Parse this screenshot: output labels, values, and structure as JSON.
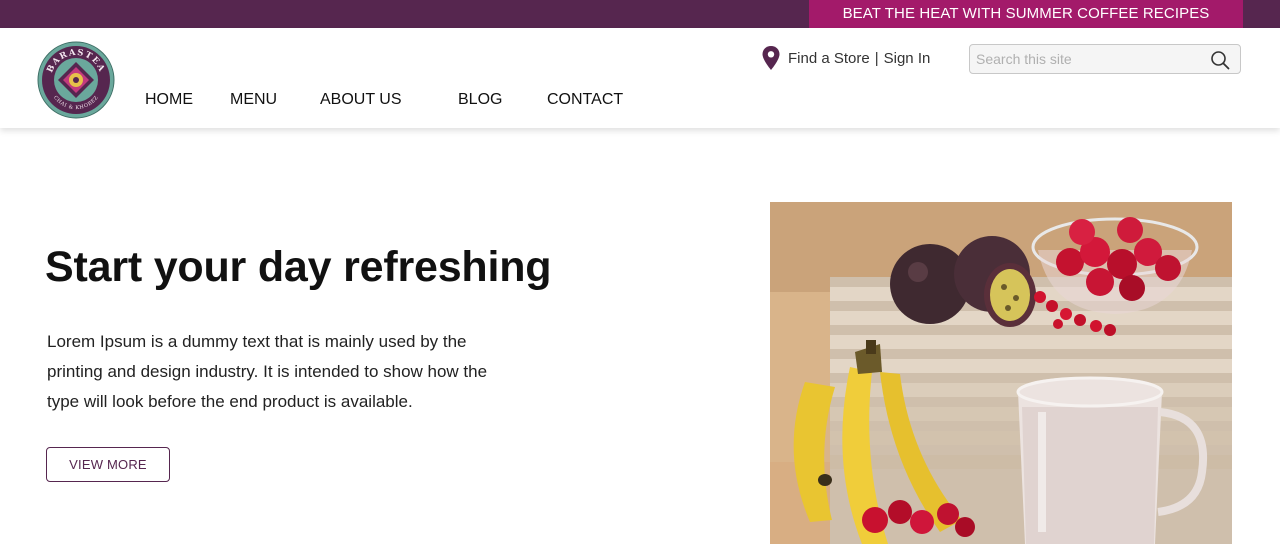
{
  "promo_banner": {
    "text": "BEAT THE HEAT WITH SUMMER COFFEE RECIPES"
  },
  "logo": {
    "brand": "BARASTEA",
    "tagline": "CHAI & KHOBEZ",
    "icon": "barastea-logo"
  },
  "nav": {
    "items": [
      {
        "label": "HOME"
      },
      {
        "label": "MENU"
      },
      {
        "label": "ABOUT US"
      },
      {
        "label": "BLOG"
      },
      {
        "label": "CONTACT"
      }
    ]
  },
  "utility": {
    "find_store": "Find a Store",
    "separator": "|",
    "sign_in": "Sign In",
    "icon": "location-pin-icon"
  },
  "search": {
    "placeholder": "Search this site",
    "value": "",
    "icon": "search-icon"
  },
  "hero": {
    "title": "Start your day refreshing",
    "body": "Lorem Ipsum is a dummy text that is mainly used by the printing and design industry. It is intended to show how the type will look before the end product is available.",
    "button_label": "VIEW MORE"
  },
  "colors": {
    "brand_purple": "#56264f",
    "promo_magenta": "#a31a6a",
    "logo_teal": "#5fa89a"
  }
}
